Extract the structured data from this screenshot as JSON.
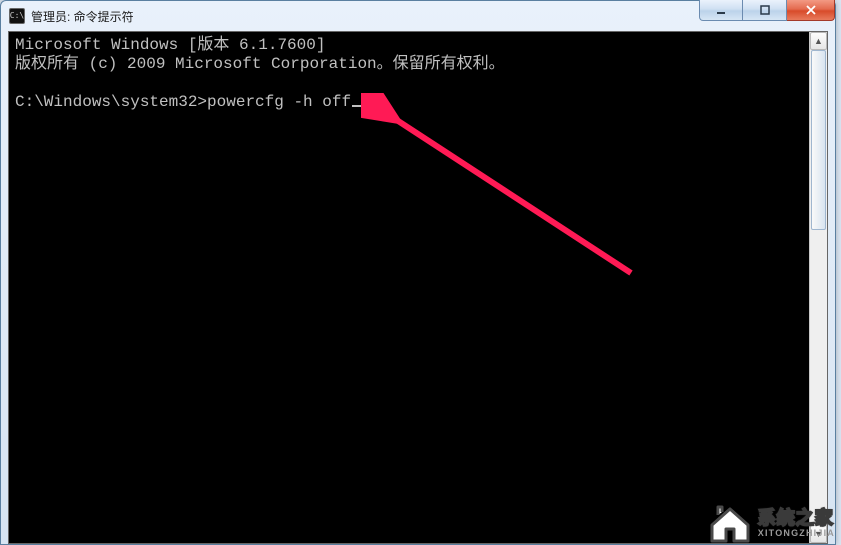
{
  "window": {
    "title": "管理员: 命令提示符"
  },
  "console": {
    "line1": "Microsoft Windows [版本 6.1.7600]",
    "line2": "版权所有 (c) 2009 Microsoft Corporation。保留所有权利。",
    "prompt": "C:\\Windows\\system32>",
    "command": "powercfg -h off"
  },
  "watermark": {
    "cn": "系统之家",
    "en": "XITONGZHIJIA"
  }
}
